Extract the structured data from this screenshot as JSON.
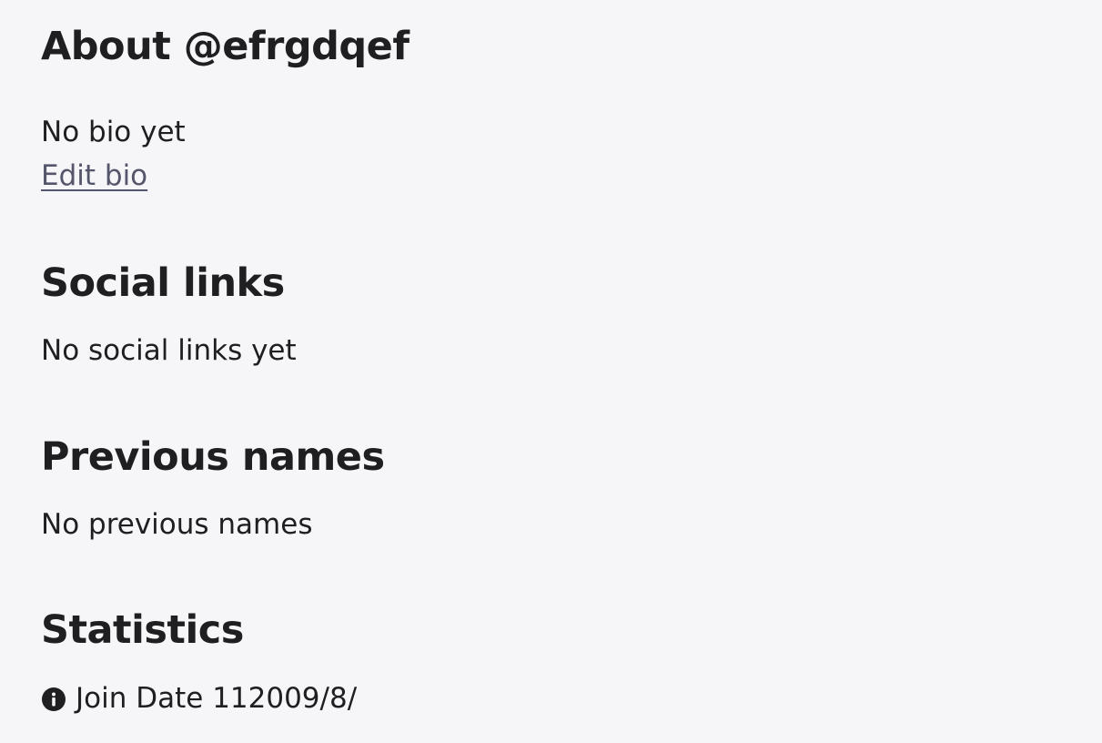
{
  "about": {
    "title": "About @efrgdqef",
    "bio_text": "No bio yet",
    "edit_bio_label": "Edit bio"
  },
  "social_links": {
    "title": "Social links",
    "empty_text": "No social links yet"
  },
  "previous_names": {
    "title": "Previous names",
    "empty_text": "No previous names"
  },
  "statistics": {
    "title": "Statistics",
    "join_date_label": "Join Date",
    "join_date_value": "112009/8/",
    "icon": "info-icon"
  },
  "colors": {
    "background": "#f6f6f8",
    "text": "#1f1f21",
    "link": "#55556b"
  }
}
